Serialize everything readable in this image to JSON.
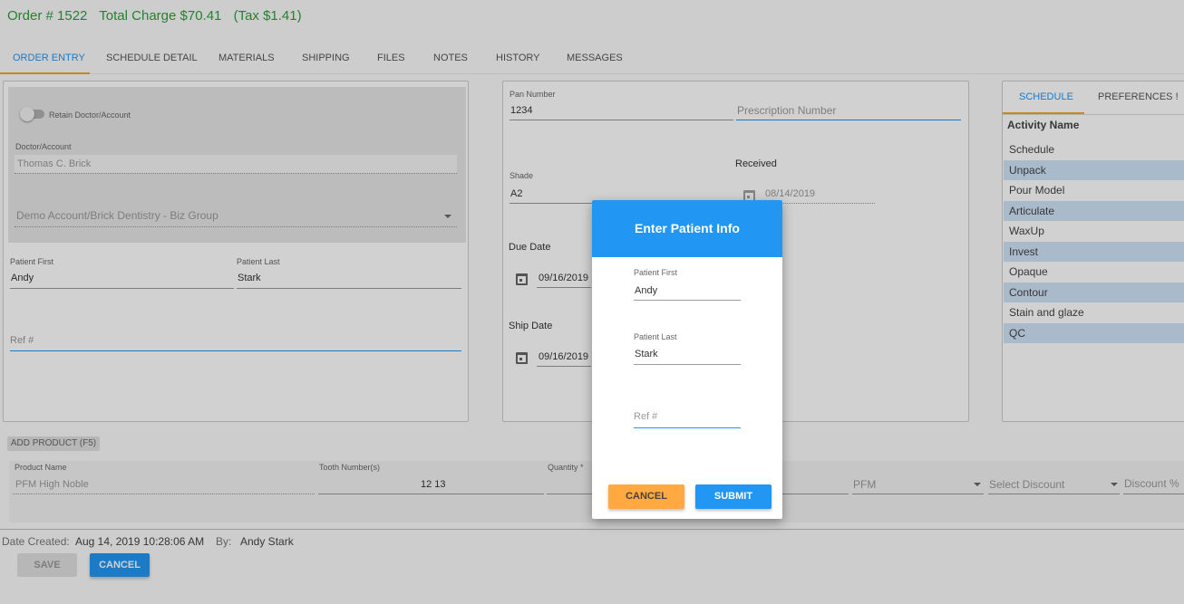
{
  "header": {
    "order": "Order # 1522",
    "total": "Total Charge $70.41",
    "tax": "(Tax $1.41)"
  },
  "tabs": [
    "ORDER ENTRY",
    "SCHEDULE DETAIL",
    "MATERIALS",
    "SHIPPING",
    "FILES",
    "NOTES",
    "HISTORY",
    "MESSAGES"
  ],
  "left_panel": {
    "retain_label": "Retain Doctor/Account",
    "doctor_label": "Doctor/Account",
    "doctor_value": "Thomas C. Brick",
    "account_value": "Demo Account/Brick Dentistry - Biz Group",
    "patient_first_label": "Patient First",
    "patient_first_value": "Andy",
    "patient_last_label": "Patient Last",
    "patient_last_value": "Stark",
    "ref_placeholder": "Ref #"
  },
  "mid_panel": {
    "pan_label": "Pan Number",
    "pan_value": "1234",
    "rx_placeholder": "Prescription Number",
    "shade_label": "Shade",
    "shade_value": "A2",
    "received_label": "Received",
    "received_value": "08/14/2019",
    "due_label": "Due Date",
    "due_value": "09/16/2019",
    "ship_label": "Ship Date",
    "ship_value": "09/16/2019"
  },
  "right_panel": {
    "tab_schedule": "SCHEDULE",
    "tab_preferences": "PREFERENCES !",
    "activity_header": "Activity Name",
    "activities": [
      "Schedule",
      "Unpack",
      "Pour Model",
      "Articulate",
      "WaxUp",
      "Invest",
      "Opaque",
      "Contour",
      "Stain and glaze",
      "QC"
    ]
  },
  "products": {
    "add_button": "ADD PRODUCT (F5)",
    "product_label": "Product Name",
    "product_value": "PFM High Noble",
    "tooth_label": "Tooth Number(s)",
    "tooth_value": "12 13",
    "quantity_label": "Quantity *",
    "material_value": "PFM",
    "discount_placeholder": "Select Discount",
    "discount_pct_placeholder": "Discount %"
  },
  "footer": {
    "created_label": "Date Created:",
    "created_value": "Aug 14, 2019 10:28:06 AM",
    "by_label": "By:",
    "by_value": "Andy Stark",
    "save_label": "SAVE",
    "cancel_label": "CANCEL"
  },
  "dialog": {
    "title": "Enter Patient Info",
    "first_label": "Patient First",
    "first_value": "Andy",
    "last_label": "Patient Last",
    "last_value": "Stark",
    "ref_placeholder": "Ref #",
    "cancel_label": "CANCEL",
    "submit_label": "SUBMIT"
  },
  "colors": {
    "accent": "#2196f3",
    "header_green": "#2e9e3a",
    "cancel_orange": "#ffa940",
    "tab_underline": "#f5a623"
  }
}
